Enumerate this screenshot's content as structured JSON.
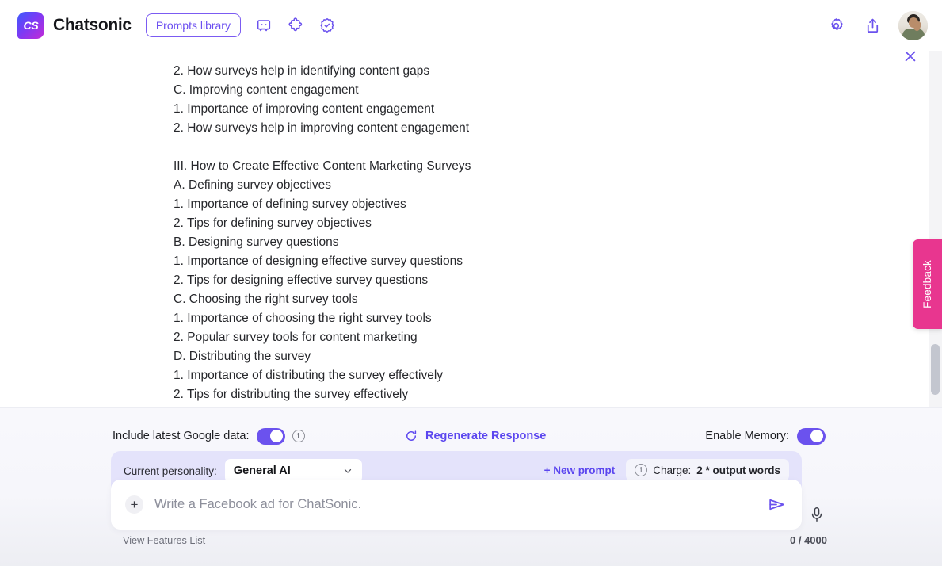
{
  "header": {
    "logo_text": "CS",
    "brand": "Chatsonic",
    "prompts_library": "Prompts library",
    "icons": [
      {
        "name": "discord-icon"
      },
      {
        "name": "puzzle-extension-icon"
      },
      {
        "name": "verified-badge-icon"
      }
    ],
    "right_icons": [
      {
        "name": "settings-gear-icon"
      },
      {
        "name": "share-upload-icon"
      }
    ],
    "avatar_name": "user-avatar"
  },
  "close_button_label": "×",
  "feedback_tab": {
    "label": "Feedback",
    "color": "#e8368f"
  },
  "conversation": {
    "outline_lines": [
      "2. How surveys help in identifying content gaps",
      "C. Improving content engagement",
      "1. Importance of improving content engagement",
      "2. How surveys help in improving content engagement",
      "",
      "III. How to Create Effective Content Marketing Surveys",
      "A. Defining survey objectives",
      "1. Importance of defining survey objectives",
      "2. Tips for defining survey objectives",
      "B. Designing survey questions",
      "1. Importance of designing effective survey questions",
      "2. Tips for designing effective survey questions",
      "C. Choosing the right survey tools",
      "1. Importance of choosing the right survey tools",
      "2. Popular survey tools for content marketing",
      "D. Distributing the survey",
      "1. Importance of distributing the survey effectively",
      "2. Tips for distributing the survey effectively"
    ]
  },
  "controls": {
    "google_data_label": "Include latest Google data:",
    "google_data_toggle_on": true,
    "regenerate_label": "Regenerate Response",
    "memory_label": "Enable Memory:",
    "memory_toggle_on": true,
    "accent_color": "#5b46ef",
    "toggle_on_color": "#6b52ee"
  },
  "personality": {
    "label": "Current personality:",
    "selected": "General AI",
    "new_prompt_label": "+ New prompt",
    "charge_label": "Charge:",
    "charge_value": "2 * output words"
  },
  "composer": {
    "plus_label": "+",
    "placeholder": "Write a Facebook ad for ChatSonic.",
    "value": "",
    "view_features": "View Features List",
    "char_count": "0 / 4000"
  }
}
